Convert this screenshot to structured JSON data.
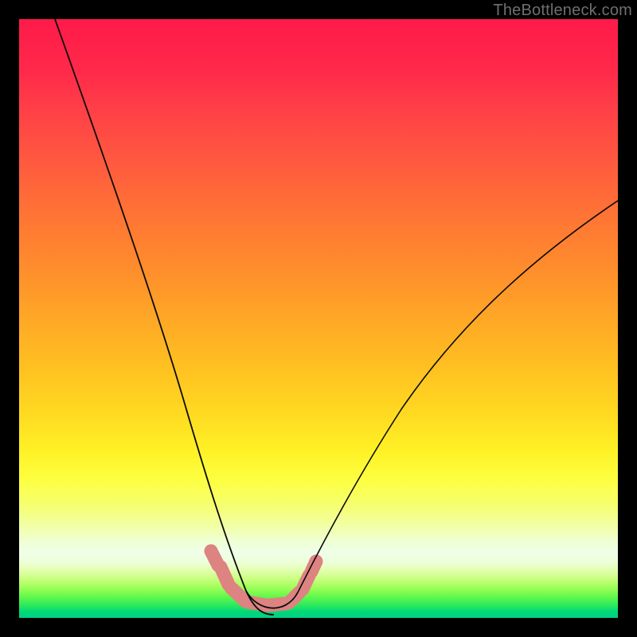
{
  "watermark": {
    "text": "TheBottleneck.com"
  },
  "colors": {
    "curve": "#0b0b0b",
    "beads": "#dd8382",
    "background_black": "#000000"
  },
  "chart_data": {
    "type": "line",
    "title": "",
    "xlabel": "",
    "ylabel": "",
    "xlim": [
      0,
      100
    ],
    "ylim": [
      0,
      100
    ],
    "grid": false,
    "legend": false,
    "note": "Axes unlabeled; values estimated from pixel positions on a 0–100 normalized scale. y=0 at bottom, y=100 at top.",
    "series": [
      {
        "name": "left-curve",
        "x": [
          6,
          10,
          14,
          18,
          22,
          24,
          26,
          28,
          30,
          32,
          33,
          34,
          35,
          36,
          37,
          38
        ],
        "y": [
          100,
          85,
          70,
          56,
          42,
          36,
          30,
          24,
          18,
          13,
          10,
          8,
          6,
          5,
          4,
          3
        ]
      },
      {
        "name": "trough",
        "x": [
          38,
          39,
          40,
          41,
          42,
          43,
          44,
          45
        ],
        "y": [
          3,
          2.4,
          2.1,
          2.0,
          2.0,
          2.1,
          2.3,
          2.7
        ]
      },
      {
        "name": "right-curve",
        "x": [
          45,
          47,
          50,
          55,
          60,
          65,
          70,
          75,
          80,
          85,
          90,
          95,
          100
        ],
        "y": [
          2.7,
          5,
          9,
          17,
          25,
          33,
          40,
          47,
          53,
          58,
          63,
          67,
          70
        ]
      },
      {
        "name": "beads-highlight",
        "x": [
          33,
          34.5,
          36,
          38,
          40,
          42,
          44,
          45.8,
          47.2,
          48.3
        ],
        "y": [
          11,
          8.5,
          5.6,
          3.0,
          2.2,
          2.2,
          2.6,
          4.0,
          6.0,
          8.0
        ]
      }
    ]
  }
}
